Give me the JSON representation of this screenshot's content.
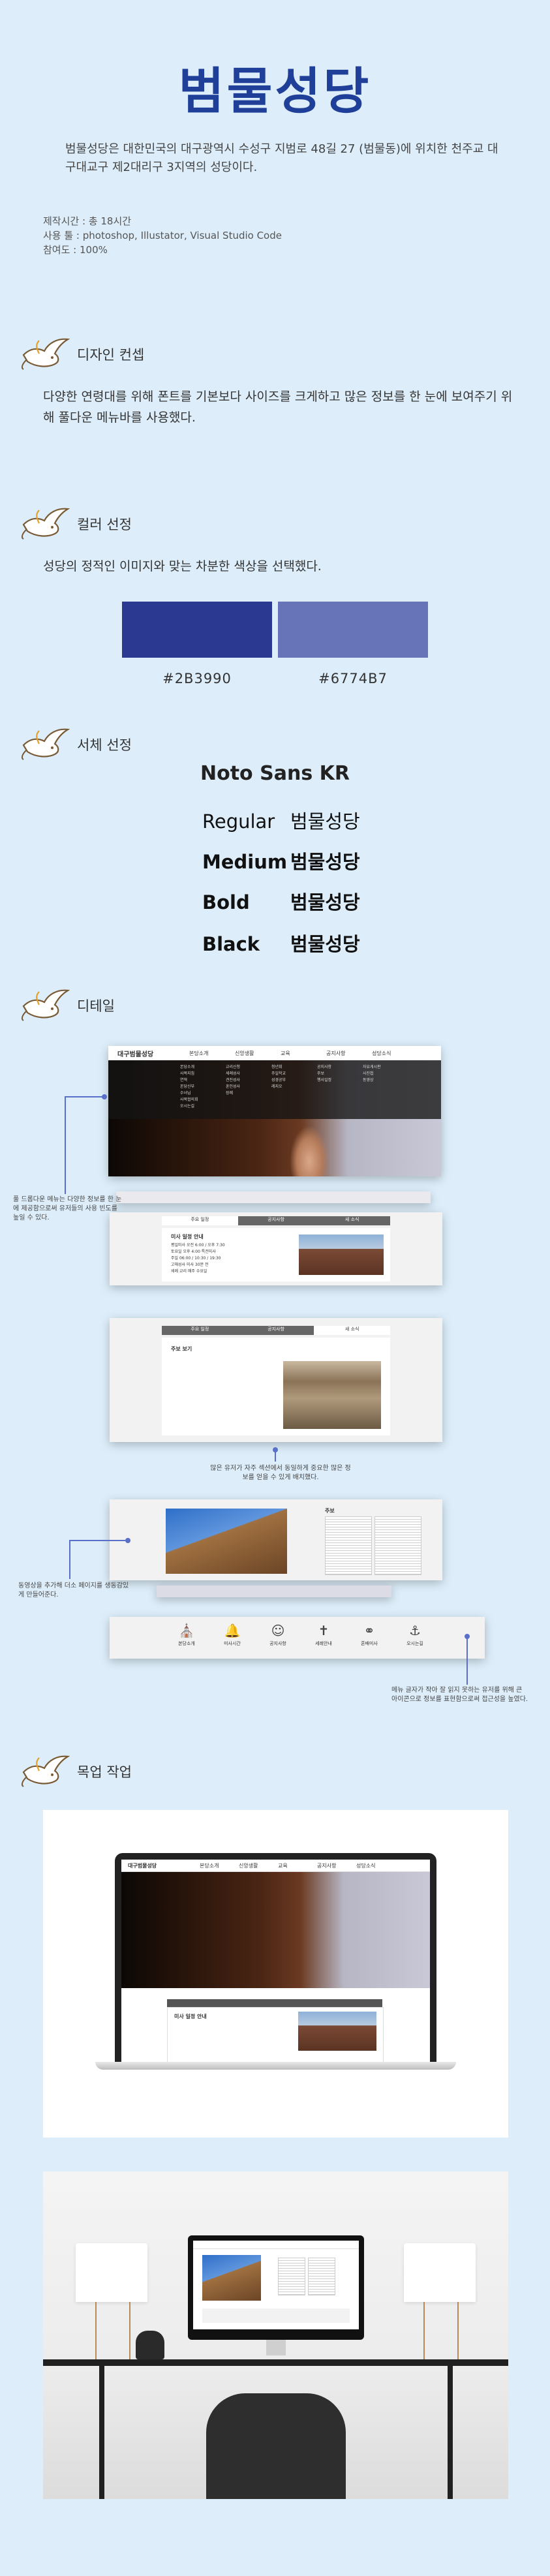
{
  "header": {
    "title": "범물성당",
    "intro": "범물성당은 대한민국의 대구광역시 수성구 지범로 48길 27 (범물동)에 위치한 천주교 대구대교구 제2대리구 3지역의 성당이다.",
    "meta": [
      "제작시간 : 총 18시간",
      "사용 툴 : photoshop, Illustator, Visual Studio Code",
      "참여도 : 100%"
    ]
  },
  "sections": {
    "concept": {
      "heading": "디자인 컨셉",
      "body": "다양한 연령대를 위해 폰트를 기본보다 사이즈를 크게하고 많은 정보를 한 눈에 보여주기 위해 풀다운 메뉴바를 사용했다."
    },
    "color": {
      "heading": "컬러 선정",
      "body": "성당의 정적인 이미지와 맞는 차분한 색상을 선택했다.",
      "swatches": [
        {
          "hex": "#2B3990",
          "label": "#2B3990"
        },
        {
          "hex": "#6774B7",
          "label": "#6774B7"
        }
      ]
    },
    "font": {
      "heading": "서체 선정",
      "family": "Noto Sans KR",
      "rows": [
        {
          "weight": "Regular",
          "sample": "범물성당"
        },
        {
          "weight": "Medium",
          "sample": "범물성당"
        },
        {
          "weight": "Bold",
          "sample": "범물성당"
        },
        {
          "weight": "Black",
          "sample": "범물성당"
        }
      ]
    },
    "detail": {
      "heading": "디테일",
      "notes": [
        "풀 드롭다운 메뉴는 다양한 정보를 한 눈에 제공함으로써 유저들의 사용 빈도를 높일 수 있다.",
        "많은 유저가 자주 섹션에서 동일하게 중요한 많은 정보를 얻을 수 있게 배치했다.",
        "동영상을 추가해 더소 페이지를 생동감있게 만들어준다.",
        "메뉴 글자가 작아 잘 읽지 못하는 유저를 위해 큰 아이콘으로 정보를 표현함으로써 접근성을 높였다."
      ],
      "site": {
        "logo": "대구범물성당",
        "nav": [
          "본당소개",
          "신앙생활",
          "교육",
          "공지사항",
          "성당소식"
        ],
        "menu_cols": [
          [
            "본당소개",
            "사목지침",
            "연혁",
            "본당신부",
            "수녀님",
            "사목협의회",
            "오시는길"
          ],
          [
            "교리신청",
            "세례성사",
            "견진성사",
            "혼인성사",
            "장례"
          ],
          [
            "청년회",
            "주일학교",
            "성경공부",
            "레지오"
          ],
          [
            "공지사항",
            "주보",
            "행사일정"
          ],
          [
            "자유게시판",
            "사진첩",
            "동영상"
          ]
        ],
        "panel_tabs": [
          "주요 일정",
          "공지사항",
          "새 소식"
        ],
        "panel_title": "미사 일정 안내",
        "panel_lines": [
          "평일미사 오전 6:00 / 오후 7:30",
          "토요일 오후 4:00 특전미사",
          "주일 06:00 / 10:30 / 19:30",
          "고해성사 미사 30분 전",
          "세례 교리 매주 수요일"
        ],
        "panel2_title": "주보 보기",
        "news_title": "주보",
        "icons": [
          {
            "label": "본당소개",
            "icon": "church-icon"
          },
          {
            "label": "미사시간",
            "icon": "bell-icon"
          },
          {
            "label": "공지사항",
            "icon": "person-icon"
          },
          {
            "label": "세례안내",
            "icon": "cross-icon"
          },
          {
            "label": "혼배미사",
            "icon": "rings-icon"
          },
          {
            "label": "오시는길",
            "icon": "anchor-icon"
          }
        ]
      }
    },
    "mockup": {
      "heading": "목업 작업"
    }
  },
  "colors": {
    "brand": "#1f3f98",
    "primary": "#2B3990",
    "secondary": "#6774B7",
    "bg": "#ddeefa",
    "pin": "#8a6a43"
  }
}
